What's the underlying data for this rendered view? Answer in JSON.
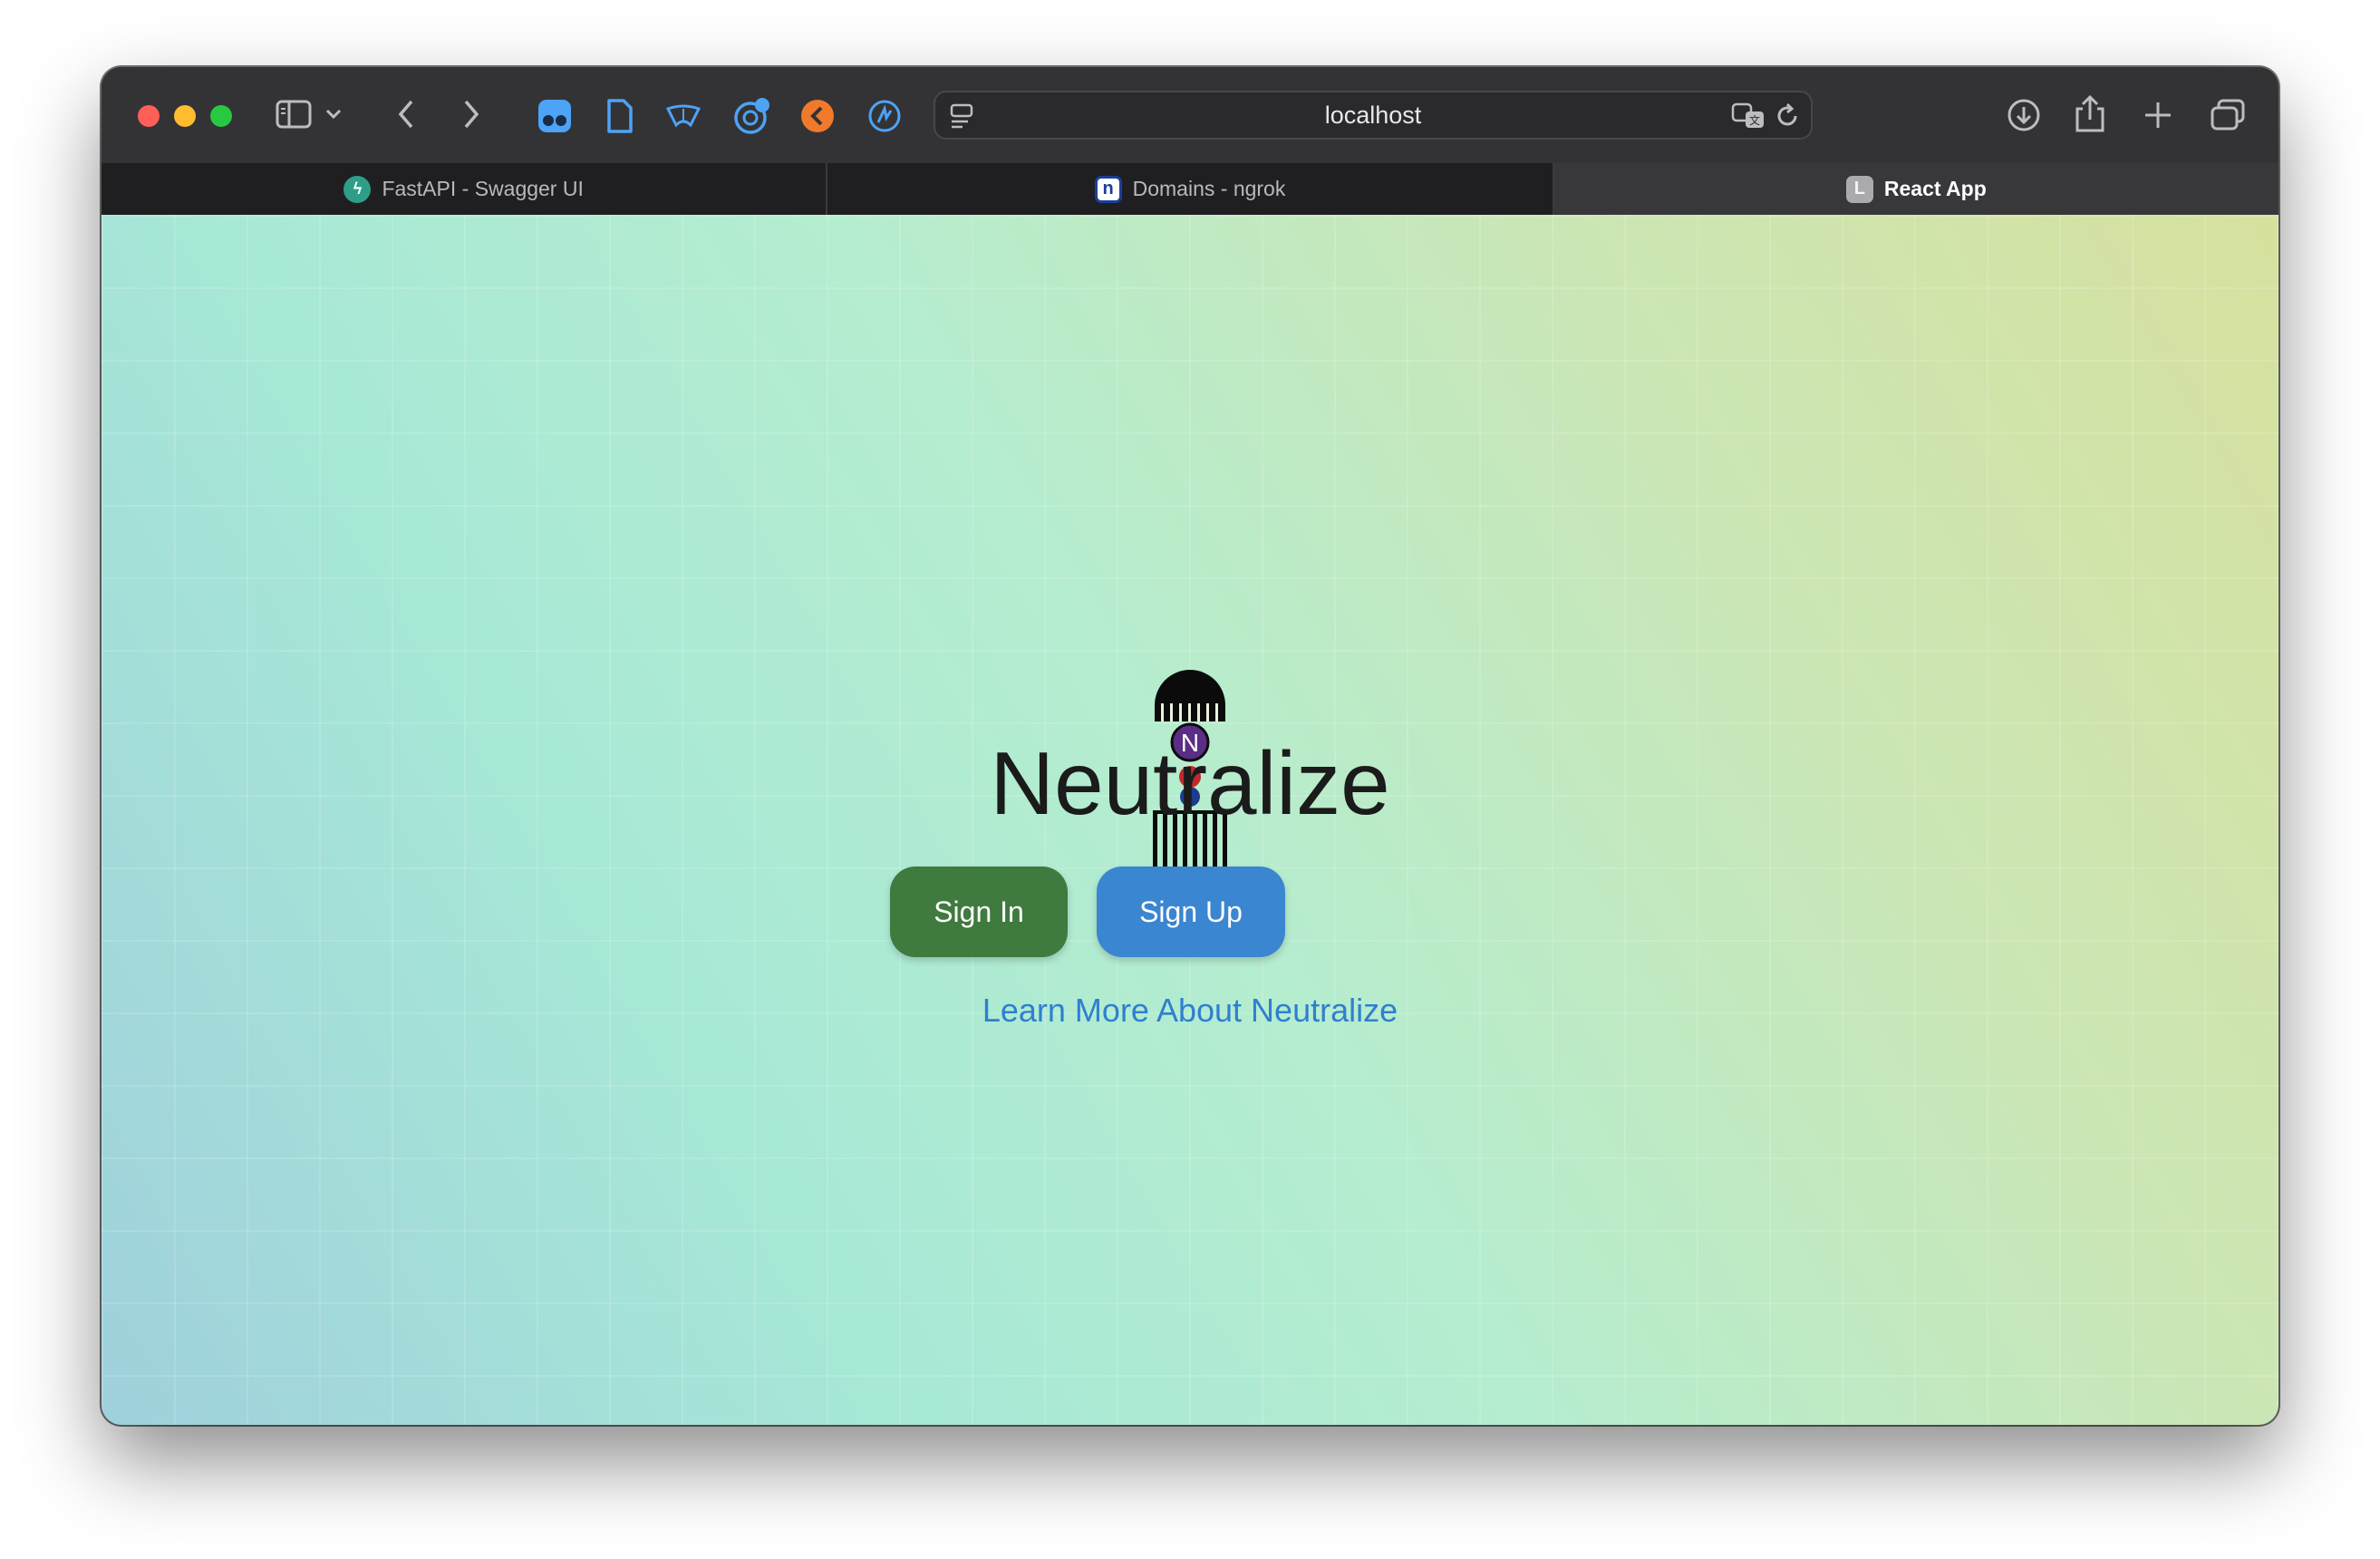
{
  "browser": {
    "url": "localhost",
    "tabs": [
      {
        "label": "FastAPI - Swagger UI",
        "icon": "fastapi-favicon",
        "active": false
      },
      {
        "label": "Domains - ngrok",
        "icon": "ngrok-favicon",
        "active": false
      },
      {
        "label": "React App",
        "icon": "react-app-favicon",
        "active": true
      }
    ],
    "tab_favicon_letters": {
      "ngrok": "n",
      "react": "L"
    }
  },
  "page": {
    "logo_letter": "N",
    "title": "Neutralize",
    "signin_label": "Sign In",
    "signup_label": "Sign Up",
    "learn_more_label": "Learn More About Neutralize"
  },
  "colors": {
    "signin": "#3f7a3f",
    "signup": "#3a86d0",
    "link": "#2f7fd0",
    "logo_purple": "#5b2d86",
    "logo_red": "#c0282c",
    "logo_blue": "#1f3c8c"
  }
}
